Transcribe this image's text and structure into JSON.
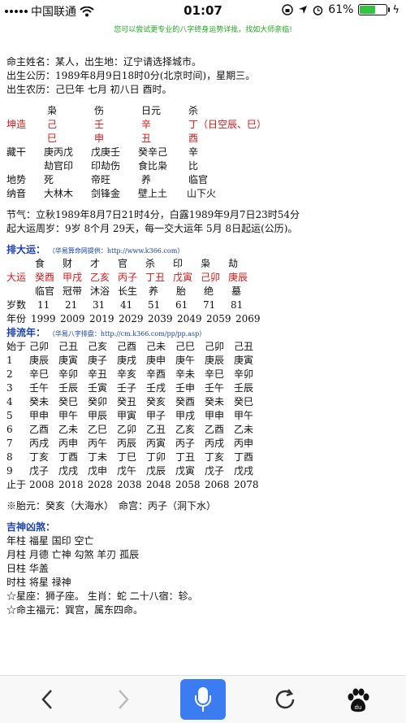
{
  "status_bar": {
    "carrier": "中国联通",
    "time": "01:07",
    "battery_percent": "61%",
    "battery_level": 0.61
  },
  "promo_text": "您可以尝试更专业的八字终身运势详批，找如大师亲临!",
  "info": {
    "line1": "命主姓名：某人，出生地：辽宁请选择城市。",
    "line2": "出生公历：1989年8月9日18时0分(北京时间)，星期三。",
    "line3": "出生农历：己巳年 七月 初八日 酉时。"
  },
  "bazi": {
    "header": [
      "枭",
      "伤",
      "日元",
      "杀"
    ],
    "qian_label": "坤造",
    "tiangan": [
      "己",
      "壬",
      "辛",
      "丁（日空辰、巳）"
    ],
    "dizhi": [
      "巳",
      "申",
      "丑",
      "酉"
    ],
    "canggan_label": "藏干",
    "canggan": [
      "庚丙戊",
      "戊庚壬",
      "癸辛己",
      "辛"
    ],
    "shishen": [
      "劫官印",
      "印劫伤",
      "食比枭",
      "比"
    ],
    "dishi_label": "地势",
    "dishi": [
      "死",
      "帝旺",
      "养",
      "临官"
    ],
    "nayin_label": "纳音",
    "nayin": [
      "大林木",
      "剑锋金",
      "壁上土",
      "山下火"
    ]
  },
  "jieqi": "节气：立秋1989年8月7日21时4分，白露1989年9月7日23时54分",
  "qiyun": "起大运周岁：9岁 8个月 29天，每一交大运年 5月 8日起运(公历)。",
  "dayun": {
    "title": "排大运：",
    "note": "（华易算命网提供：http://www.k366.com）",
    "shishen": [
      "食",
      "财",
      "才",
      "官",
      "杀",
      "印",
      "枭",
      "劫"
    ],
    "label": "大运",
    "ganzhi": [
      "癸酉",
      "甲戌",
      "乙亥",
      "丙子",
      "丁丑",
      "戊寅",
      "己卯",
      "庚辰"
    ],
    "changsheng": [
      "临官",
      "冠带",
      "沐浴",
      "长生",
      "养",
      "胎",
      "绝",
      "墓"
    ],
    "age_label": "岁数",
    "ages": [
      "11",
      "21",
      "31",
      "41",
      "51",
      "61",
      "71",
      "81"
    ],
    "year_label": "年份",
    "years": [
      "1999",
      "2009",
      "2019",
      "2029",
      "2039",
      "2049",
      "2059",
      "2069"
    ]
  },
  "liunian": {
    "title": "排流年：",
    "note": "（华易八字排盘：http://cm.k366.com/pp/pp.asp）",
    "start_label": "始于",
    "start": [
      "己卯",
      "己丑",
      "己亥",
      "己酉",
      "己未",
      "己巳",
      "己卯",
      "己丑"
    ],
    "rows": [
      {
        "n": "1",
        "v": [
          "庚辰",
          "庚寅",
          "庚子",
          "庚戌",
          "庚申",
          "庚午",
          "庚辰",
          "庚寅"
        ]
      },
      {
        "n": "2",
        "v": [
          "辛巳",
          "辛卯",
          "辛丑",
          "辛亥",
          "辛酉",
          "辛未",
          "辛巳",
          "辛卯"
        ]
      },
      {
        "n": "3",
        "v": [
          "壬午",
          "壬辰",
          "壬寅",
          "壬子",
          "壬戌",
          "壬申",
          "壬午",
          "壬辰"
        ]
      },
      {
        "n": "4",
        "v": [
          "癸未",
          "癸巳",
          "癸卯",
          "癸丑",
          "癸亥",
          "癸酉",
          "癸未",
          "癸巳"
        ]
      },
      {
        "n": "5",
        "v": [
          "甲申",
          "甲午",
          "甲辰",
          "甲寅",
          "甲子",
          "甲戌",
          "甲申",
          "甲午"
        ]
      },
      {
        "n": "6",
        "v": [
          "乙酉",
          "乙未",
          "乙巳",
          "乙卯",
          "乙丑",
          "乙亥",
          "乙酉",
          "乙未"
        ]
      },
      {
        "n": "7",
        "v": [
          "丙戌",
          "丙申",
          "丙午",
          "丙辰",
          "丙寅",
          "丙子",
          "丙戌",
          "丙申"
        ]
      },
      {
        "n": "8",
        "v": [
          "丁亥",
          "丁酉",
          "丁未",
          "丁巳",
          "丁卯",
          "丁丑",
          "丁亥",
          "丁酉"
        ]
      },
      {
        "n": "9",
        "v": [
          "戊子",
          "戊戌",
          "戊申",
          "戊午",
          "戊辰",
          "戊寅",
          "戊子",
          "戊戌"
        ]
      }
    ],
    "end_label": "止于",
    "end": [
      "2008",
      "2018",
      "2028",
      "2038",
      "2048",
      "2058",
      "2068",
      "2078"
    ]
  },
  "taiyuan": "※胎元：癸亥（大海水）　命宫：丙子（洞下水）",
  "shensha": {
    "title": "吉神凶煞：",
    "lines": [
      "年柱 福星 国印 空亡",
      "月柱 月德 亡神 勾煞 羊刃 孤辰",
      "日柱 华盖",
      "时柱 将星 禄神",
      "☆星座：狮子座。 生肖：蛇 二十八宿：轸。",
      "☆命主福元：巽宫，属东四命。"
    ]
  },
  "colors": {
    "red": "#d41a1a",
    "blue": "#1a3fb3",
    "green": "#22aa22",
    "accent": "#3b7cf2"
  },
  "icons": [
    "wifi-icon",
    "lock-rotation-icon",
    "location-icon",
    "alarm-icon",
    "back-icon",
    "forward-icon",
    "mic-icon",
    "refresh-icon",
    "baidu-paw-icon"
  ]
}
